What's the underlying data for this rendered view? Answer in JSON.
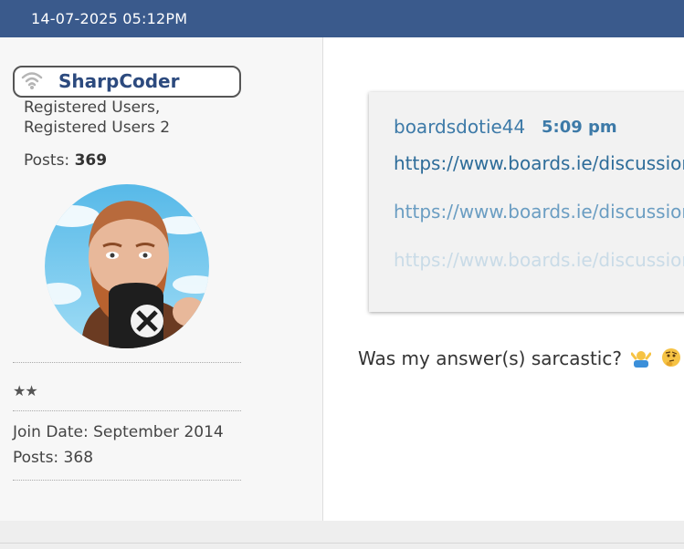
{
  "post": {
    "date": "14-07-2025 05:12PM"
  },
  "user": {
    "name": "SharpCoder",
    "status_icon": "wifi-icon",
    "group_line1": "Registered Users,",
    "group_line2": "Registered Users 2",
    "posts_label": "Posts: ",
    "posts_value": "369",
    "stars": "★★",
    "join_date": "Join Date: September 2014",
    "posts_bottom": "Posts: 368"
  },
  "quote": {
    "author": "boardsdotie44",
    "time": "5:09 pm",
    "links": [
      "https://www.boards.ie/discussion/",
      "https://www.boards.ie/discussion/",
      "https://www.boards.ie/discussion/"
    ]
  },
  "message": {
    "text": "Was my answer(s) sarcastic?",
    "emojis": [
      "shrug-icon",
      "thinking-face-icon"
    ]
  }
}
